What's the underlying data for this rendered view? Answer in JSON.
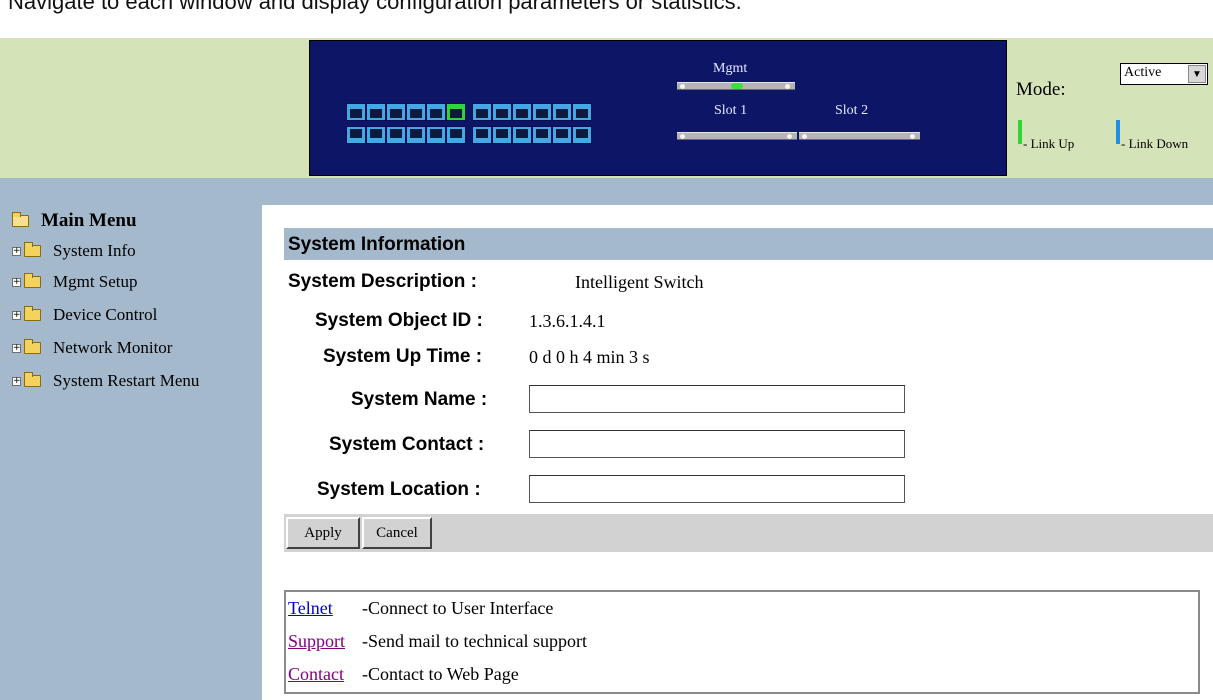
{
  "intro_text": "Navigate to each window and display configuration parameters or statistics.",
  "device_panel": {
    "mgmt_label": "Mgmt",
    "slot1_label": "Slot 1",
    "slot2_label": "Slot 2",
    "port_status": "port 6 link up"
  },
  "mode": {
    "label": "Mode:",
    "selected": "Active"
  },
  "legend": {
    "link_up": "Link Up",
    "link_down": "Link Down",
    "link_up_color": "#33d23a",
    "link_down_color": "#1f8fe8"
  },
  "sidebar": {
    "title": "Main Menu",
    "items": [
      {
        "label": "System Info"
      },
      {
        "label": "Mgmt Setup"
      },
      {
        "label": "Device Control"
      },
      {
        "label": "Network Monitor"
      },
      {
        "label": "System Restart Menu"
      }
    ]
  },
  "main": {
    "section_title": "System Information",
    "fields": {
      "description_label": "System Description :",
      "description_value": "Intelligent Switch",
      "object_id_label": "System Object ID :",
      "object_id_value": "1.3.6.1.4.1",
      "uptime_label": "System Up Time :",
      "uptime_value": "0 d 0 h 4 min 3 s",
      "name_label": "System Name :",
      "name_value": "",
      "contact_label": "System Contact :",
      "contact_value": "",
      "location_label": "System Location :",
      "location_value": ""
    },
    "buttons": {
      "apply": "Apply",
      "cancel": "Cancel"
    }
  },
  "links": [
    {
      "text": "Telnet",
      "desc": "-Connect to User Interface",
      "color": "#0000cc"
    },
    {
      "text": "Support",
      "desc": "-Send mail to technical support",
      "color": "#800080"
    },
    {
      "text": "Contact",
      "desc": "-Contact to Web Page",
      "color": "#800080"
    }
  ],
  "colors": {
    "header_bg": "#d5e4b8",
    "sidebar_bg": "#a4b9cb",
    "panel_bg": "#0c1566",
    "port_color": "#44a7e6"
  }
}
